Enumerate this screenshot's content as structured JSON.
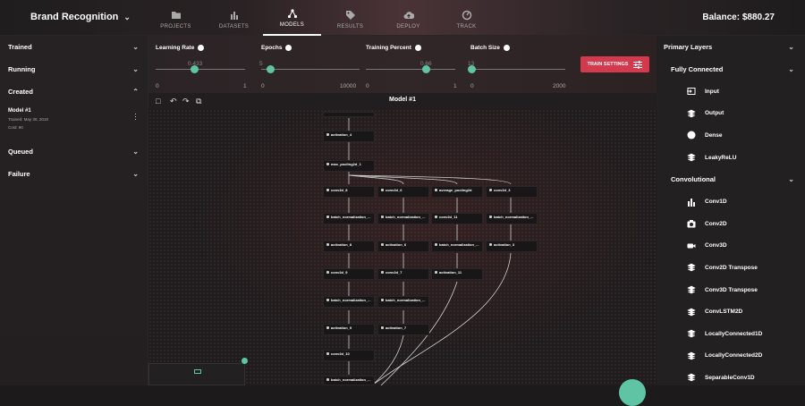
{
  "header": {
    "project": "Brand Recognition",
    "tabs": [
      {
        "label": "PROJECTS",
        "icon": "folder-icon"
      },
      {
        "label": "DATASETS",
        "icon": "bar-chart-icon"
      },
      {
        "label": "MODELS",
        "icon": "network-icon",
        "active": true
      },
      {
        "label": "RESULTS",
        "icon": "tag-icon"
      },
      {
        "label": "DEPLOY",
        "icon": "cloud-upload-icon"
      },
      {
        "label": "TRACK",
        "icon": "gauge-icon"
      }
    ],
    "balance": "Balance: $880.27"
  },
  "left": {
    "trained": "Trained",
    "running": "Running",
    "created": "Created",
    "model": {
      "name": "Model #1",
      "trained": "Trained: May 30, 2019",
      "cost": "Cost: 90"
    },
    "queued": "Queued",
    "failure": "Failure"
  },
  "params": {
    "learning_rate": {
      "label": "Learning Rate",
      "value": "0.433",
      "min": "0",
      "max": "1",
      "fraction": 0.433
    },
    "epochs": {
      "label": "Epochs",
      "value": "5",
      "min": "0",
      "max": "10000",
      "fraction": 0.0005
    },
    "training_percent": {
      "label": "Training Percent",
      "value": "0.66",
      "min": "0",
      "max": "1",
      "fraction": 0.66
    },
    "batch_size": {
      "label": "Batch Size",
      "value": "13",
      "min": "0",
      "max": "2000",
      "fraction": 0.0065
    },
    "train_button": "TRAIN SETTINGS"
  },
  "toolbar": {
    "title": "Model #1"
  },
  "graph": {
    "nodes": [
      {
        "label": "activation_4"
      },
      {
        "label": "max_pooling2d_1"
      },
      {
        "label": "conv2d_8"
      },
      {
        "label": "conv2d_6"
      },
      {
        "label": "average_pooling2d"
      },
      {
        "label": "conv2d_3"
      },
      {
        "label": "batch_normalization_..."
      },
      {
        "label": "batch_normalization_..."
      },
      {
        "label": "conv2d_11"
      },
      {
        "label": "batch_normalization_..."
      },
      {
        "label": "activation_8"
      },
      {
        "label": "activation_6"
      },
      {
        "label": "batch_normalization_..."
      },
      {
        "label": "activation_3"
      },
      {
        "label": "conv2d_9"
      },
      {
        "label": "conv2d_7"
      },
      {
        "label": "activation_11"
      },
      {
        "label": "batch_normalization_..."
      },
      {
        "label": "batch_normalization_..."
      },
      {
        "label": "activation_9"
      },
      {
        "label": "activation_7"
      },
      {
        "label": "conv2d_10"
      },
      {
        "label": "batch_normalization_..."
      }
    ]
  },
  "right": {
    "primary": "Primary Layers",
    "fully_connected": "Fully Connected",
    "fc_items": [
      {
        "label": "Input",
        "icon": "input-icon"
      },
      {
        "label": "Output",
        "icon": "layers-icon"
      },
      {
        "label": "Dense",
        "icon": "circle-icon"
      },
      {
        "label": "LeakyReLU",
        "icon": "layers-icon"
      }
    ],
    "convolutional": "Convolutional",
    "conv_items": [
      {
        "label": "Conv1D",
        "icon": "bar-chart-icon"
      },
      {
        "label": "Conv2D",
        "icon": "camera-icon"
      },
      {
        "label": "Conv3D",
        "icon": "video-icon"
      },
      {
        "label": "Conv2D Transpose",
        "icon": "layers-icon"
      },
      {
        "label": "Conv3D Transpose",
        "icon": "layers-icon"
      },
      {
        "label": "ConvLSTM2D",
        "icon": "layers-icon"
      },
      {
        "label": "LocallyConnected1D",
        "icon": "layers-icon"
      },
      {
        "label": "LocallyConnected2D",
        "icon": "layers-icon"
      },
      {
        "label": "SeparableConv1D",
        "icon": "layers-icon"
      }
    ]
  }
}
